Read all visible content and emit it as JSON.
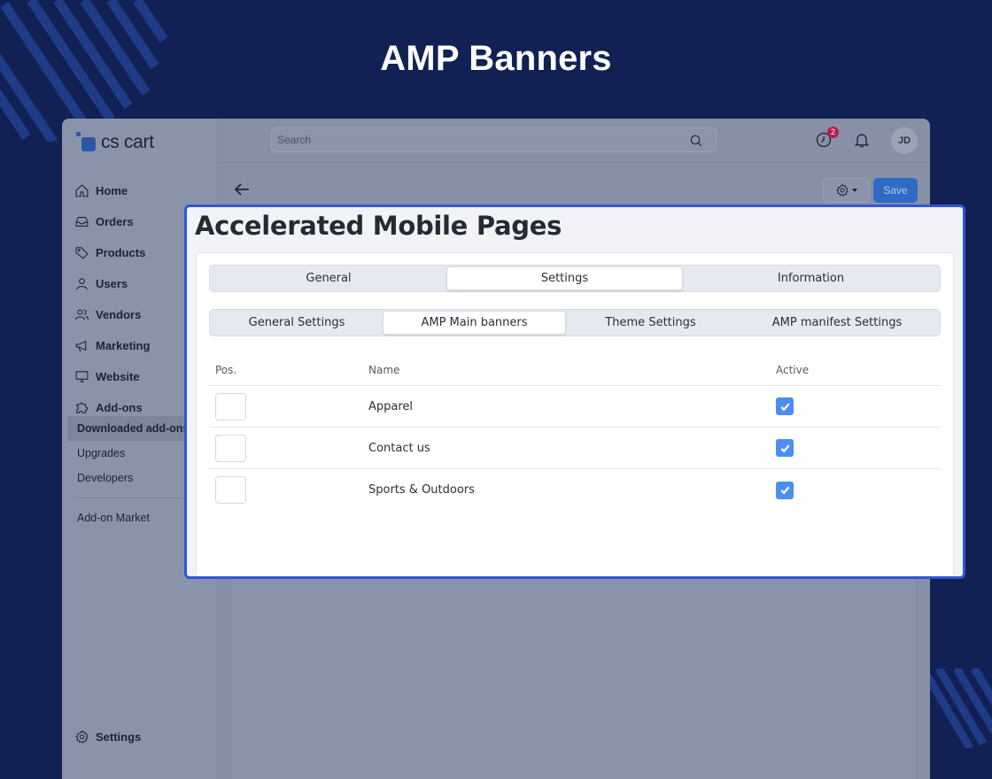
{
  "hero": {
    "title": "AMP Banners"
  },
  "app": {
    "logo": {
      "text": "cs cart"
    },
    "search": {
      "placeholder": "Search"
    },
    "notifications": {
      "badge": "2"
    },
    "user": {
      "initials": "JD"
    },
    "sidebar": {
      "items": [
        {
          "label": "Home",
          "icon": "home-icon"
        },
        {
          "label": "Orders",
          "icon": "inbox-icon"
        },
        {
          "label": "Products",
          "icon": "tag-icon"
        },
        {
          "label": "Users",
          "icon": "user-icon"
        },
        {
          "label": "Vendors",
          "icon": "users-icon"
        },
        {
          "label": "Marketing",
          "icon": "megaphone-icon"
        },
        {
          "label": "Website",
          "icon": "monitor-icon"
        },
        {
          "label": "Add-ons",
          "icon": "puzzle-icon"
        }
      ],
      "subitems": [
        {
          "label": "Downloaded add-ons",
          "active": true
        },
        {
          "label": "Upgrades"
        },
        {
          "label": "Developers"
        },
        {
          "label": "Add-on Market"
        }
      ],
      "settings": {
        "label": "Settings",
        "icon": "gear-icon"
      }
    },
    "toolbar": {
      "save_label": "Save"
    }
  },
  "modal": {
    "title": "Accelerated Mobile Pages",
    "tabs": [
      {
        "label": "General"
      },
      {
        "label": "Settings",
        "active": true
      },
      {
        "label": "Information"
      }
    ],
    "subtabs": [
      {
        "label": "General Settings"
      },
      {
        "label": "AMP Main banners",
        "active": true
      },
      {
        "label": "Theme Settings"
      },
      {
        "label": "AMP manifest Settings"
      }
    ],
    "table": {
      "headers": {
        "pos": "Pos.",
        "name": "Name",
        "active": "Active"
      },
      "rows": [
        {
          "pos": "",
          "name": "Apparel",
          "active": true
        },
        {
          "pos": "",
          "name": "Contact us",
          "active": true
        },
        {
          "pos": "",
          "name": "Sports & Outdoors",
          "active": true
        }
      ]
    }
  },
  "colors": {
    "background": "#122154",
    "modal_border": "#3056d8",
    "checkbox": "#4c8ef0",
    "save_button": "#2f6bc6"
  }
}
